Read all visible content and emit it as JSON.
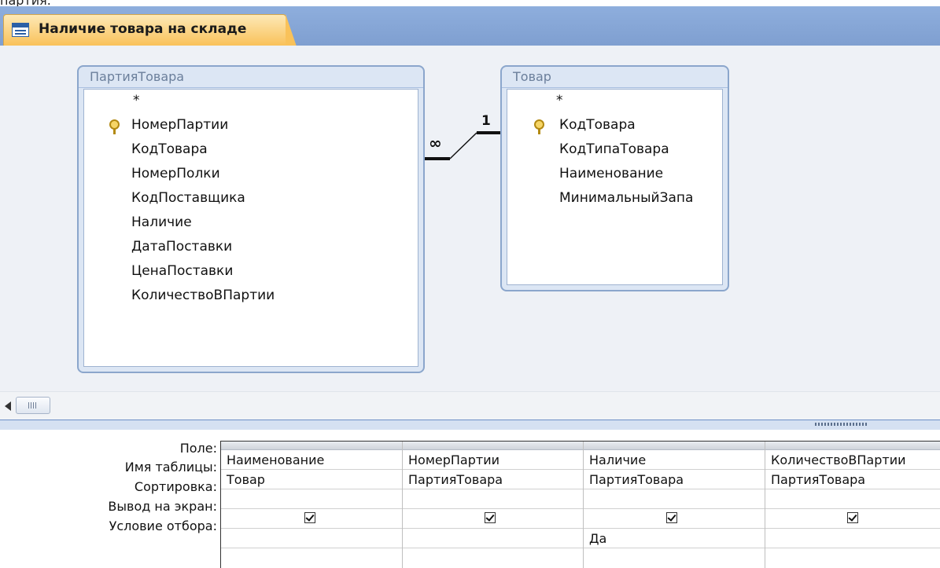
{
  "window": {
    "tab_title": "Наличие товара на складе",
    "top_fragment": "партия."
  },
  "tables": {
    "left": {
      "title": "ПартияТовара",
      "fields": [
        "*",
        "НомерПартии",
        "КодТовара",
        "НомерПолки",
        "КодПоставщика",
        "Наличие",
        "ДатаПоставки",
        "ЦенаПоставки",
        "КоличествоВПартии"
      ],
      "key_field": "НомерПартии"
    },
    "right": {
      "title": "Товар",
      "fields": [
        "*",
        "КодТовара",
        "КодТипаТовара",
        "Наименование",
        "МинимальныйЗапа"
      ],
      "key_field": "КодТовара"
    }
  },
  "relationship": {
    "many_label": "∞",
    "one_label": "1"
  },
  "grid": {
    "row_labels": {
      "field": "Поле:",
      "table": "Имя таблицы:",
      "sort": "Сортировка:",
      "show": "Вывод на экран:",
      "criteria": "Условие отбора:"
    },
    "columns": [
      {
        "field": "Наименование",
        "table": "Товар",
        "sort": "",
        "show": true,
        "criteria": ""
      },
      {
        "field": "НомерПартии",
        "table": "ПартияТовара",
        "sort": "",
        "show": true,
        "criteria": ""
      },
      {
        "field": "Наличие",
        "table": "ПартияТовара",
        "sort": "",
        "show": true,
        "criteria": "Да"
      },
      {
        "field": "КоличествоВПартии",
        "table": "ПартияТовара",
        "sort": "",
        "show": true,
        "criteria": ""
      }
    ]
  },
  "colors": {
    "tab_bar": "#8eaedd",
    "tab_active": "#f9c25a",
    "design_bg": "#eef1f6",
    "table_frame": "#8ba6cc"
  }
}
